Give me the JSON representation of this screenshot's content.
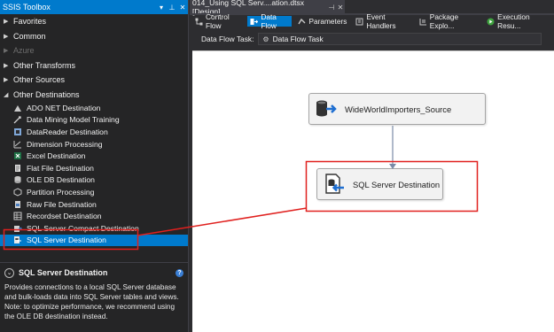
{
  "toolbox": {
    "title": "SSIS Toolbox",
    "categories": [
      {
        "label": "Favorites",
        "state": "collapsed"
      },
      {
        "label": "Common",
        "state": "collapsed"
      },
      {
        "label": "Azure",
        "state": "disabled"
      },
      {
        "label": "Other Transforms",
        "state": "collapsed"
      },
      {
        "label": "Other Sources",
        "state": "collapsed"
      },
      {
        "label": "Other Destinations",
        "state": "expanded"
      }
    ],
    "items": [
      {
        "label": "ADO NET Destination",
        "icon": "ado-net-destination-icon"
      },
      {
        "label": "Data Mining Model Training",
        "icon": "data-mining-icon"
      },
      {
        "label": "DataReader Destination",
        "icon": "datareader-icon"
      },
      {
        "label": "Dimension Processing",
        "icon": "dimension-processing-icon"
      },
      {
        "label": "Excel Destination",
        "icon": "excel-icon"
      },
      {
        "label": "Flat File Destination",
        "icon": "flat-file-icon"
      },
      {
        "label": "OLE DB Destination",
        "icon": "oledb-icon"
      },
      {
        "label": "Partition Processing",
        "icon": "partition-icon"
      },
      {
        "label": "Raw File Destination",
        "icon": "raw-file-icon"
      },
      {
        "label": "Recordset Destination",
        "icon": "recordset-icon"
      },
      {
        "label": "SQL Server Compact Destination",
        "icon": "sql-compact-icon"
      },
      {
        "label": "SQL Server Destination",
        "icon": "sql-server-destination-icon",
        "selected": true
      }
    ],
    "description": {
      "title": "SQL Server Destination",
      "text": "Provides connections to a local SQL Server database and bulk-loads data into SQL Server tables and views. Note: to optimize performance, we recommend using the OLE DB destination instead."
    }
  },
  "document": {
    "tab_title": "014_Using SQL Serv....ation.dtsx [Design]",
    "designer_tabs": [
      {
        "label": "Control Flow",
        "icon": "control-flow-icon"
      },
      {
        "label": "Data Flow",
        "icon": "data-flow-icon",
        "active": true
      },
      {
        "label": "Parameters",
        "icon": "parameters-icon"
      },
      {
        "label": "Event Handlers",
        "icon": "event-handlers-icon"
      },
      {
        "label": "Package Explo...",
        "icon": "package-explorer-icon"
      },
      {
        "label": "Execution Resu...",
        "icon": "execution-results-icon"
      }
    ],
    "task_label": "Data Flow Task:",
    "task_value": "Data Flow Task"
  },
  "canvas": {
    "source_node": "WideWorldImporters_Source",
    "destination_node": "SQL Server Destination"
  },
  "colors": {
    "accent": "#007acc",
    "highlight_outline": "#e0201e",
    "panel_bg": "#252526",
    "canvas_bg": "#ffffff"
  }
}
